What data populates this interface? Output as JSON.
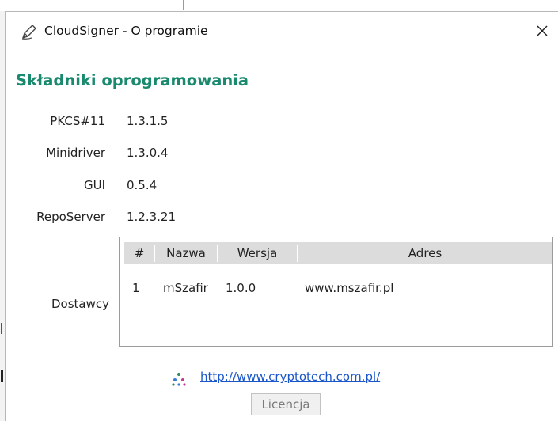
{
  "window": {
    "title": "CloudSigner - O programie",
    "icon": "pen-icon",
    "close_icon": "close-icon"
  },
  "heading": "Składniki oprogramowania",
  "components": [
    {
      "label": "PKCS#11",
      "value": "1.3.1.5"
    },
    {
      "label": "Minidriver",
      "value": "1.3.0.4"
    },
    {
      "label": "GUI",
      "value": "0.5.4"
    },
    {
      "label": "RepoServer",
      "value": "1.2.3.21"
    }
  ],
  "providers": {
    "label": "Dostawcy",
    "columns": [
      "#",
      "Nazwa",
      "Wersja",
      "Adres"
    ],
    "rows": [
      {
        "num": "1",
        "name": "mSzafir",
        "version": "1.0.0",
        "address": "www.mszafir.pl"
      }
    ]
  },
  "footer": {
    "link": "http://www.cryptotech.com.pl/",
    "license_button": "Licencja"
  },
  "colors": {
    "heading": "#1a8a6e",
    "link": "#1a55c9",
    "table_header_bg": "#dcdcdc"
  }
}
